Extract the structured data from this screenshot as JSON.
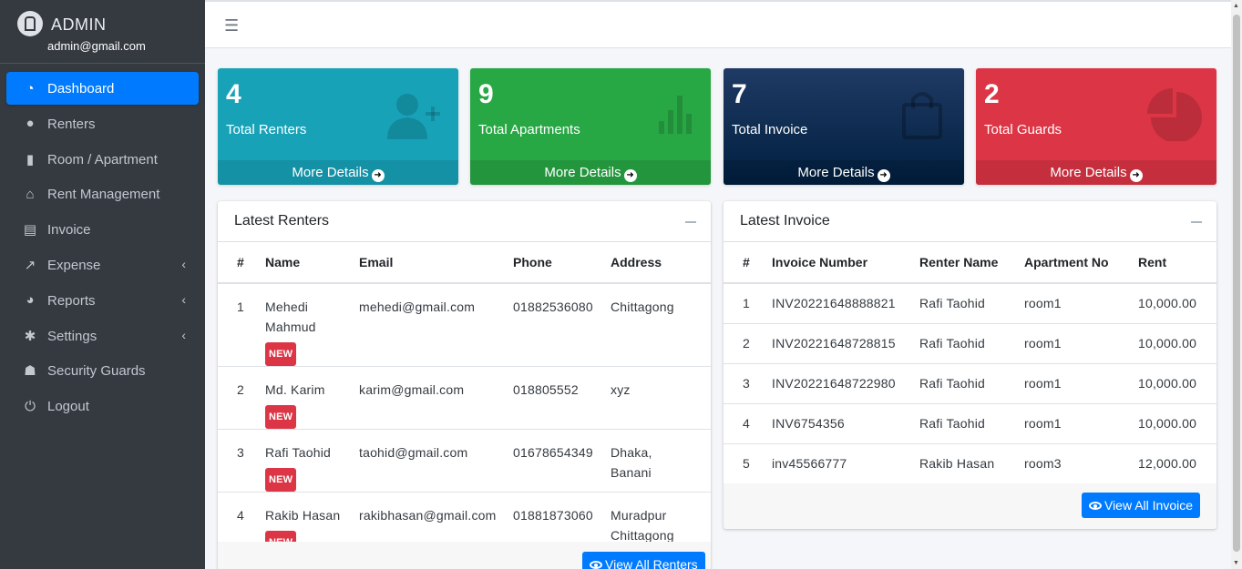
{
  "brand": {
    "title": "ADMIN",
    "email": "admin@gmail.com"
  },
  "nav": [
    {
      "label": "Dashboard",
      "icon": "tachometer-icon",
      "glyph": "◔",
      "active": true
    },
    {
      "label": "Renters",
      "icon": "user-icon",
      "glyph": "●"
    },
    {
      "label": "Room / Apartment",
      "icon": "building-icon",
      "glyph": "▮"
    },
    {
      "label": "Rent Management",
      "icon": "house-user-icon",
      "glyph": "⌂"
    },
    {
      "label": "Invoice",
      "icon": "file-invoice-icon",
      "glyph": "▤"
    },
    {
      "label": "Expense",
      "icon": "chart-line-icon",
      "glyph": "↗",
      "arrow": true
    },
    {
      "label": "Reports",
      "icon": "chart-pie-icon",
      "glyph": "◕",
      "arrow": true
    },
    {
      "label": "Settings",
      "icon": "cog-icon",
      "glyph": "✱",
      "arrow": true
    },
    {
      "label": "Security Guards",
      "icon": "user-secret-icon",
      "glyph": "☗"
    },
    {
      "label": "Logout",
      "icon": "power-off-icon",
      "glyph": "⏻"
    }
  ],
  "stats": [
    {
      "value": "4",
      "label": "Total Renters",
      "more": "More Details",
      "color": "#17a2b8",
      "icon": "user-plus-icon"
    },
    {
      "value": "9",
      "label": "Total Apartments",
      "more": "More Details",
      "color": "#28a745",
      "icon": "bar-chart-icon"
    },
    {
      "value": "7",
      "label": "Total Invoice",
      "more": "More Details",
      "color": "#001f3f",
      "icon": "shopping-bag-icon"
    },
    {
      "value": "2",
      "label": "Total Guards",
      "more": "More Details",
      "color": "#dc3545",
      "icon": "pie-chart-icon"
    }
  ],
  "renters": {
    "title": "Latest Renters",
    "columns": [
      "#",
      "Name",
      "Email",
      "Phone",
      "Address"
    ],
    "badge": "NEW",
    "rows": [
      {
        "n": "1",
        "name": "Mehedi Mahmud",
        "email": "mehedi@gmail.com",
        "phone": "01882536080",
        "address": "Chittagong"
      },
      {
        "n": "2",
        "name": "Md. Karim",
        "email": "karim@gmail.com",
        "phone": "018805552",
        "address": "xyz"
      },
      {
        "n": "3",
        "name": "Rafi Taohid",
        "email": "taohid@gmail.com",
        "phone": "01678654349",
        "address": "Dhaka, Banani"
      },
      {
        "n": "4",
        "name": "Rakib Hasan",
        "email": "rakibhasan@gmail.com",
        "phone": "01881873060",
        "address": "Muradpur Chittagong"
      }
    ],
    "button": "View All Renters"
  },
  "invoices": {
    "title": "Latest Invoice",
    "columns": [
      "#",
      "Invoice Number",
      "Renter Name",
      "Apartment No",
      "Rent"
    ],
    "rows": [
      {
        "n": "1",
        "invoice": "INV20221648888821",
        "renter": "Rafi Taohid",
        "apt": "room1",
        "rent": "10,000.00"
      },
      {
        "n": "2",
        "invoice": "INV20221648728815",
        "renter": "Rafi Taohid",
        "apt": "room1",
        "rent": "10,000.00"
      },
      {
        "n": "3",
        "invoice": "INV20221648722980",
        "renter": "Rafi Taohid",
        "apt": "room1",
        "rent": "10,000.00"
      },
      {
        "n": "4",
        "invoice": "INV6754356",
        "renter": "Rafi Taohid",
        "apt": "room1",
        "rent": "10,000.00"
      },
      {
        "n": "5",
        "invoice": "inv45566777",
        "renter": "Rakib Hasan",
        "apt": "room3",
        "rent": "12,000.00"
      }
    ],
    "button": "View All Invoice"
  }
}
